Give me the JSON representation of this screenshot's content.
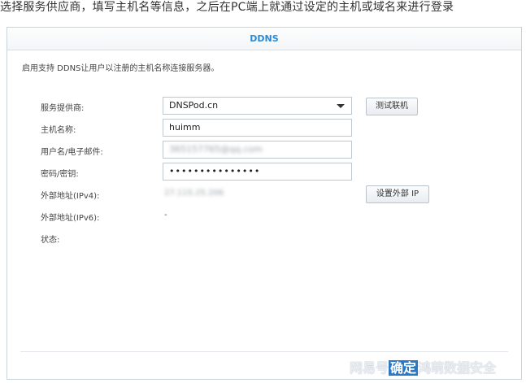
{
  "caption": "选择服务供应商，填写主机名等信息，之后在PC端上就通过设定的主机或域名来进行登录",
  "panel": {
    "title": "DDNS",
    "description": "启用支持 DDNS让用户以注册的主机名称连接服务器。"
  },
  "form": {
    "provider": {
      "label": "服务提供商:",
      "value": "DNSPod.cn"
    },
    "test_button": "测试联机",
    "hostname": {
      "label": "主机名称:",
      "value": "huimm"
    },
    "username": {
      "label": "用户名/电子邮件:",
      "value": "365157765@qq.com"
    },
    "password": {
      "label": "密码/密钥:",
      "value": "•••••••••••••••"
    },
    "external_ipv4": {
      "label": "外部地址(IPv4):",
      "value": "27.115.25.206"
    },
    "set_ip_button": "设置外部 IP",
    "external_ipv6": {
      "label": "外部地址(IPv6):",
      "value": "-"
    },
    "status": {
      "label": "状态:",
      "value": ""
    }
  },
  "watermark": {
    "left": "网易号",
    "mid": "确定",
    "right": "鸿萌数据安全"
  }
}
